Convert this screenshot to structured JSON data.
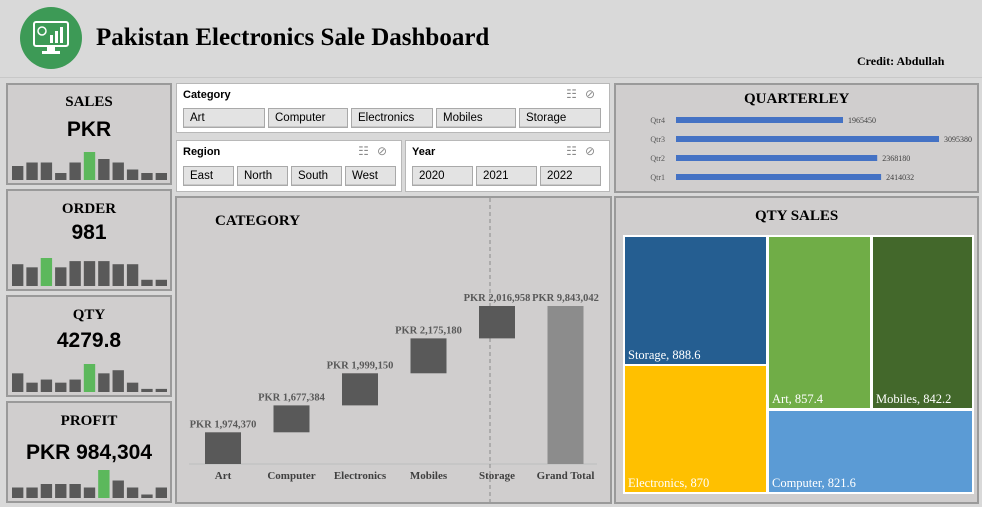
{
  "header": {
    "title": "Pakistan Electronics Sale Dashboard",
    "credit": "Credit: Abdullah"
  },
  "kpis": [
    {
      "label": "SALES",
      "value": "PKR",
      "spark": [
        4,
        5,
        5,
        2,
        5,
        8,
        6,
        5,
        3,
        2,
        2
      ],
      "highlight": 5
    },
    {
      "label": "ORDER",
      "value": "981",
      "spark": [
        7,
        6,
        9,
        6,
        8,
        8,
        8,
        7,
        7,
        2,
        2
      ],
      "highlight": 2
    },
    {
      "label": "QTY",
      "value": "4279.8",
      "spark": [
        6,
        3,
        4,
        3,
        4,
        9,
        6,
        7,
        3,
        1,
        1
      ],
      "highlight": 5
    },
    {
      "label": "PROFIT",
      "value": "PKR 984,304",
      "spark": [
        3,
        3,
        4,
        4,
        4,
        3,
        8,
        5,
        3,
        1,
        3
      ],
      "highlight": 6
    }
  ],
  "slicers": {
    "category": {
      "title": "Category",
      "items": [
        "Art",
        "Computer",
        "Electronics",
        "Mobiles",
        "Storage"
      ]
    },
    "region": {
      "title": "Region",
      "items": [
        "East",
        "North",
        "South",
        "West"
      ]
    },
    "year": {
      "title": "Year",
      "items": [
        "2020",
        "2021",
        "2022"
      ]
    }
  },
  "category_chart": {
    "title": "CATEGORY",
    "chart_data": {
      "type": "bar",
      "subtype": "waterfall",
      "categories": [
        "Art",
        "Computer",
        "Electronics",
        "Mobiles",
        "Storage",
        "Grand Total"
      ],
      "values": [
        1974370,
        1677384,
        1999150,
        2175180,
        2016958,
        9843042
      ],
      "labels": [
        "PKR 1,974,370",
        "PKR 1,677,384",
        "PKR 1,999,150",
        "PKR 2,175,180",
        "PKR 2,016,958",
        "PKR 9,843,042"
      ],
      "colors": {
        "step": "#595959",
        "total": "#8c8c8c"
      }
    }
  },
  "quarterly_chart": {
    "title": "QUARTERLEY",
    "chart_data": {
      "type": "bar",
      "orientation": "horizontal",
      "categories": [
        "Qtr4",
        "Qtr3",
        "Qtr2",
        "Qtr1"
      ],
      "values": [
        1965450,
        3095380,
        2368180,
        2414032
      ],
      "labels": [
        "1965450",
        "3095380",
        "2368180",
        "2414032"
      ],
      "color": "#4472c4"
    }
  },
  "qty_chart": {
    "title": "QTY SALES",
    "chart_data": {
      "type": "treemap",
      "categories": [
        "Storage",
        "Electronics",
        "Art",
        "Mobiles",
        "Computer"
      ],
      "values": [
        888.6,
        870,
        857.4,
        842.2,
        821.6
      ],
      "labels": [
        "Storage, 888.6",
        "Electronics, 870",
        "Art, 857.4",
        "Mobiles, 842.2",
        "Computer, 821.6"
      ],
      "colors": [
        "#255e91",
        "#ffc000",
        "#70ad47",
        "#43682b",
        "#5b9bd5"
      ]
    }
  },
  "colors": {
    "accent": "#3d9a56",
    "spark": "#595959",
    "spark_highlight": "#5cb85c",
    "quarter_bar": "#4472c4"
  }
}
